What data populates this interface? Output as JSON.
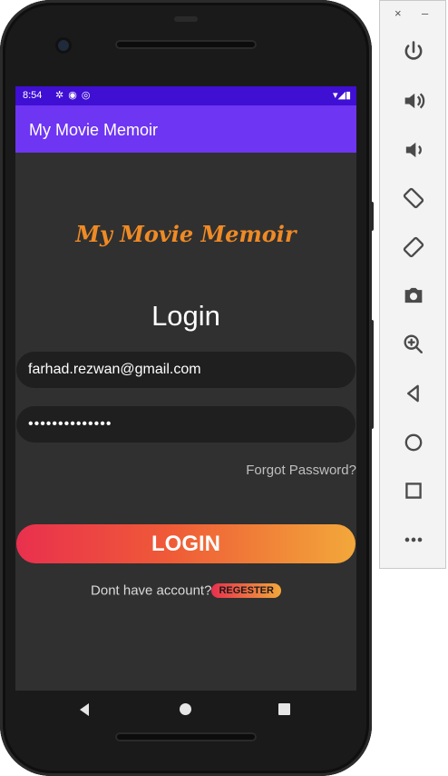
{
  "status_bar": {
    "time": "8:54"
  },
  "app_bar": {
    "title": "My Movie Memoir"
  },
  "logo_text": "My Movie Memoir",
  "login_heading": "Login",
  "email": {
    "value": "farhad.rezwan@gmail.com"
  },
  "password": {
    "masked_value": "••••••••••••••"
  },
  "forgot_password": "Forgot Password?",
  "login_button": "LOGIN",
  "signup": {
    "prompt": "Dont have account?",
    "register_button": "REGESTER"
  },
  "emulator_panel": {
    "close": "×",
    "minimize": "–",
    "tools": [
      "power-icon",
      "volume-up-icon",
      "volume-down-icon",
      "rotate-left-icon",
      "rotate-right-icon",
      "camera-icon",
      "zoom-icon",
      "back-icon",
      "home-icon",
      "overview-icon",
      "more-icon"
    ]
  },
  "colors": {
    "status_bar": "#3f0fd3",
    "app_bar": "#6e35f3",
    "background": "#303030",
    "accent_orange": "#ef8a25",
    "button_start": "#e9304e",
    "button_end": "#f2a83a"
  }
}
